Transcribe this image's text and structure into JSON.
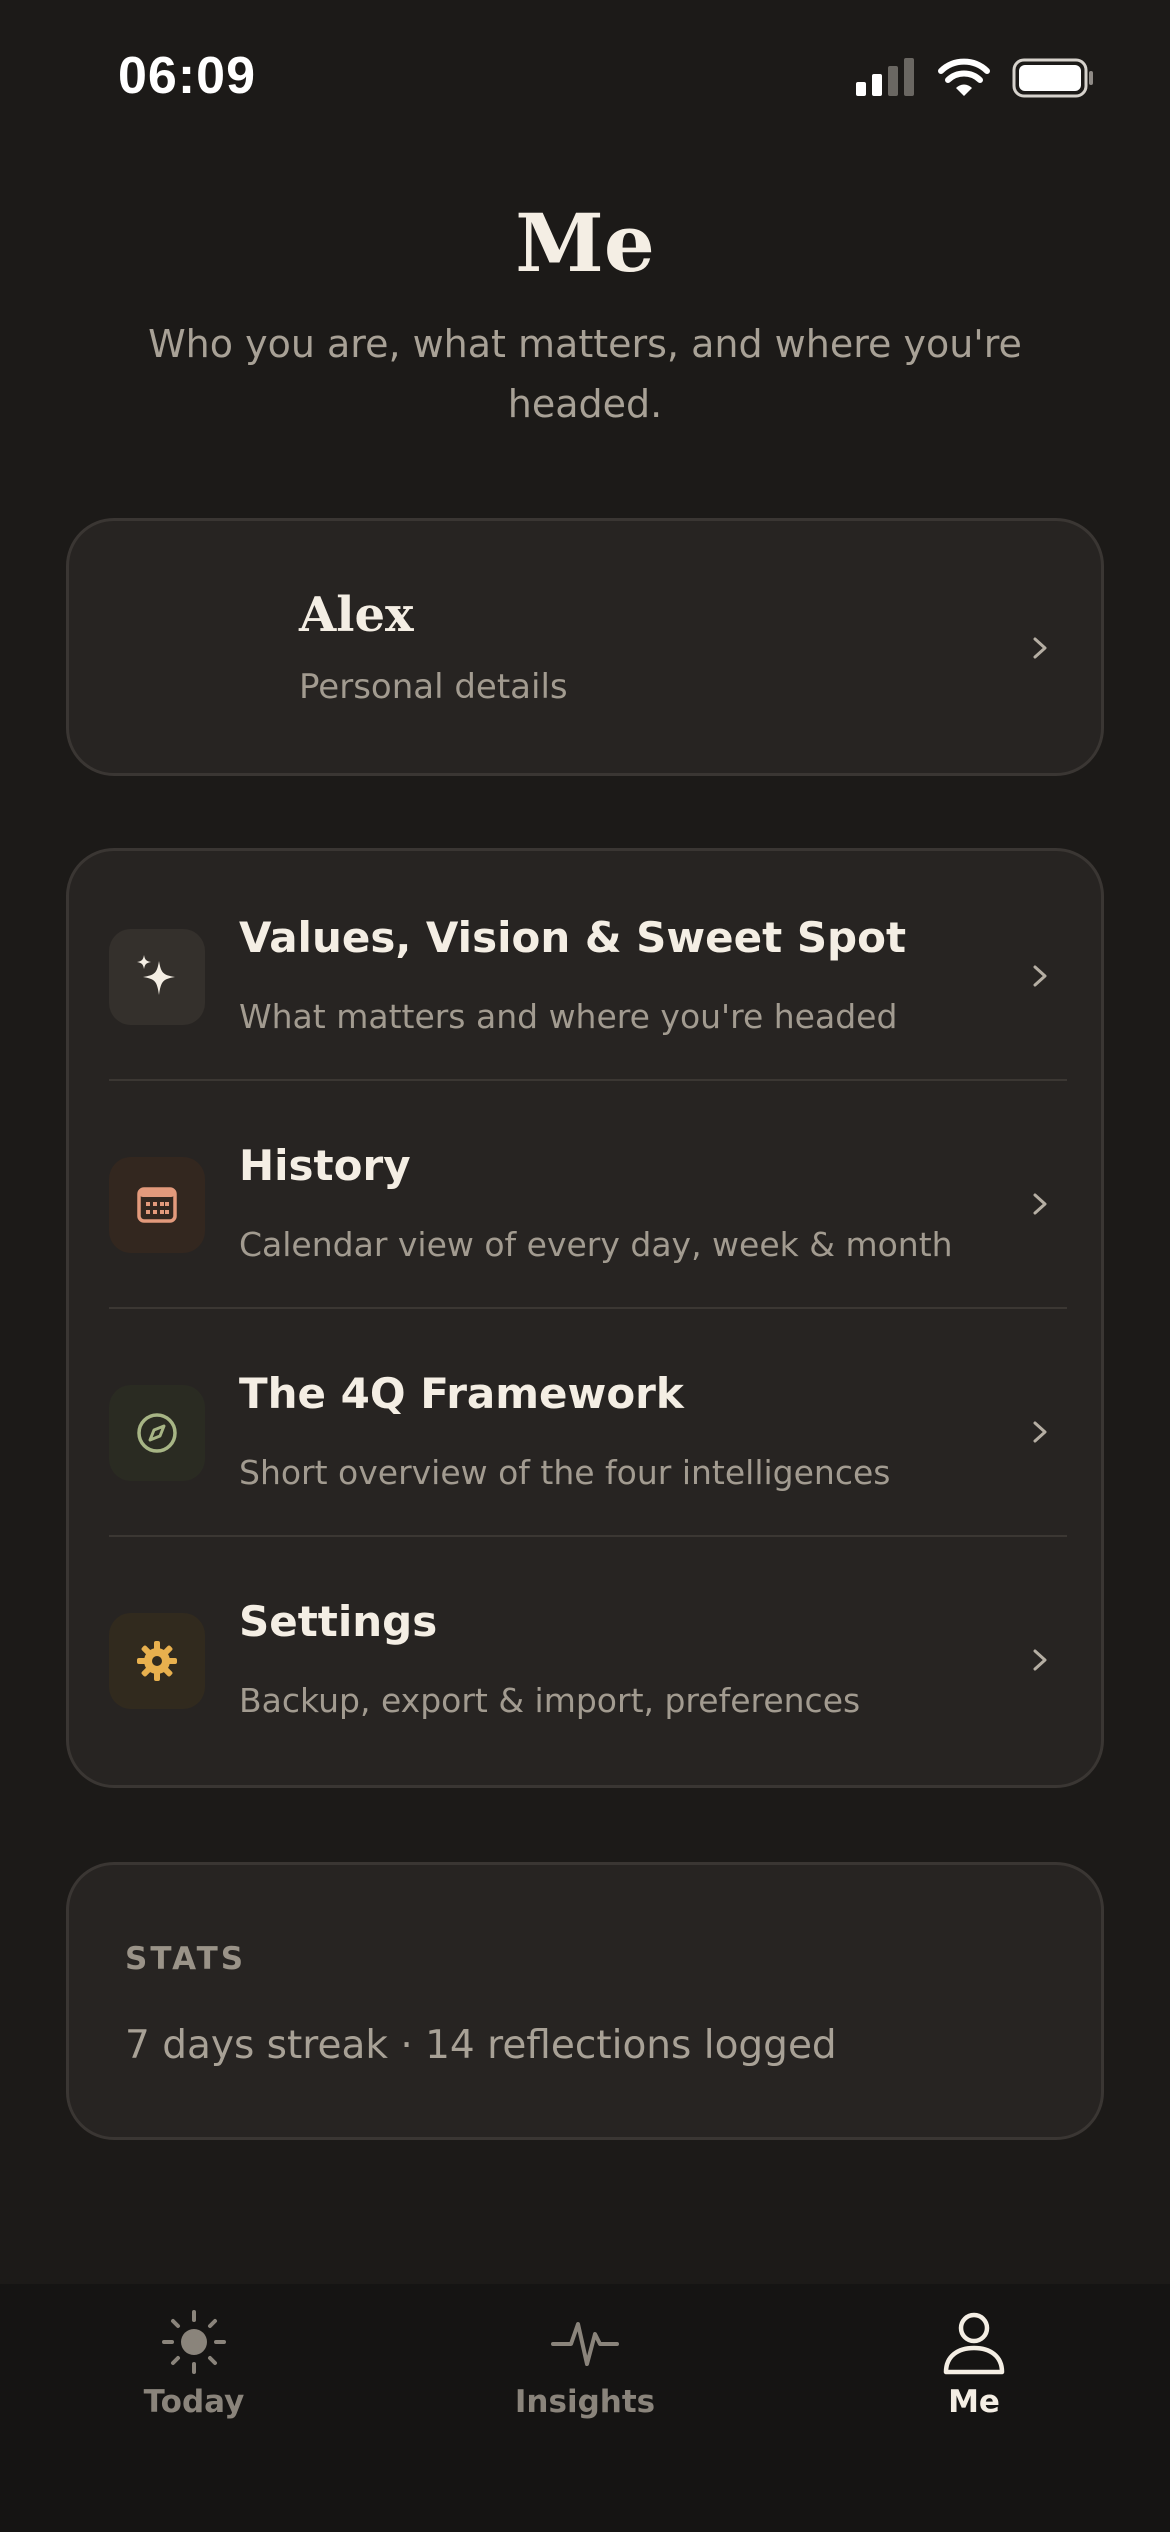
{
  "status_bar": {
    "time": "06:09",
    "icons": [
      "cellular-signal-icon",
      "wifi-icon",
      "battery-icon"
    ]
  },
  "header": {
    "title": "Me",
    "subtitle": "Who you are, what matters, and where you're headed."
  },
  "profile": {
    "name": "Alex",
    "subtitle": "Personal details",
    "icon": "chevron-right-icon"
  },
  "menu": {
    "items": [
      {
        "title": "Values, Vision & Sweet Spot",
        "description": "What matters and where you're headed",
        "icon": "sparkle-icon",
        "icon_color": "#f4eee4",
        "tile_color": "#34302c"
      },
      {
        "title": "History",
        "description": "Calendar view of every day, week & month",
        "icon": "calendar-icon",
        "icon_color": "#e39a7c",
        "tile_color": "#33271f"
      },
      {
        "title": "The 4Q Framework",
        "description": "Short overview of the four intelligences",
        "icon": "compass-icon",
        "icon_color": "#a7b585",
        "tile_color": "#2a2b22"
      },
      {
        "title": "Settings",
        "description": "Backup, export & import, preferences",
        "icon": "gear-icon",
        "icon_color": "#e8b04e",
        "tile_color": "#312a1e"
      }
    ]
  },
  "stats": {
    "label": "STATS",
    "text": "7 days streak · 14 reflections logged"
  },
  "tabs": [
    {
      "label": "Today",
      "icon": "sun-icon",
      "active": false
    },
    {
      "label": "Insights",
      "icon": "pulse-icon",
      "active": false
    },
    {
      "label": "Me",
      "icon": "person-icon",
      "active": true
    }
  ],
  "colors": {
    "background": "#1c1a18",
    "card": "#272422",
    "text_primary": "#f4eee4",
    "text_secondary": "#a29b90"
  }
}
